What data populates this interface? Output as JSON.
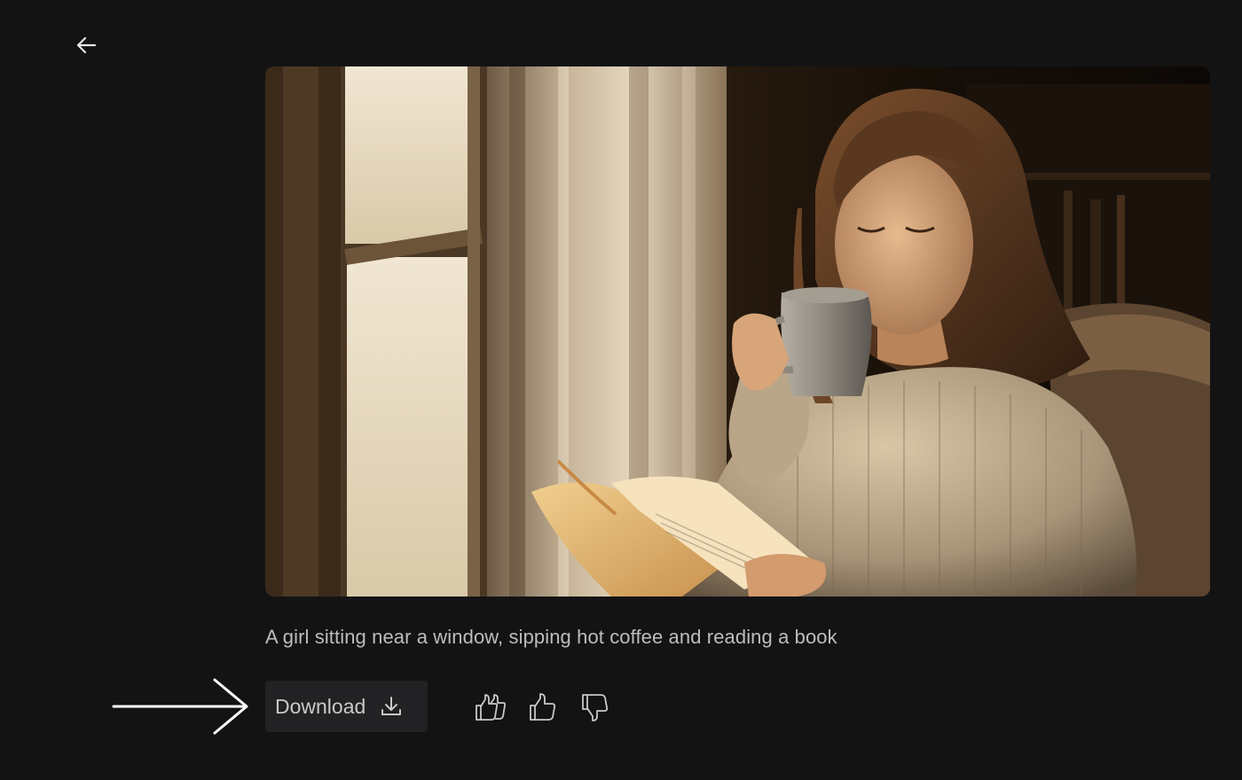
{
  "header": {
    "back_icon": "arrow-left-icon"
  },
  "image": {
    "alt": "A girl sitting near a window, sipping hot coffee and reading a book"
  },
  "caption": "A girl sitting near a window, sipping hot coffee and reading a book",
  "actions": {
    "download_label": "Download",
    "download_icon": "download-icon",
    "feedback": [
      {
        "name": "double-thumbs-up-icon"
      },
      {
        "name": "thumbs-up-icon"
      },
      {
        "name": "thumbs-down-icon"
      }
    ]
  },
  "colors": {
    "background": "#131314",
    "button_bg": "#222224",
    "text": "#bdbdbd",
    "icon": "#c9c9c9"
  }
}
